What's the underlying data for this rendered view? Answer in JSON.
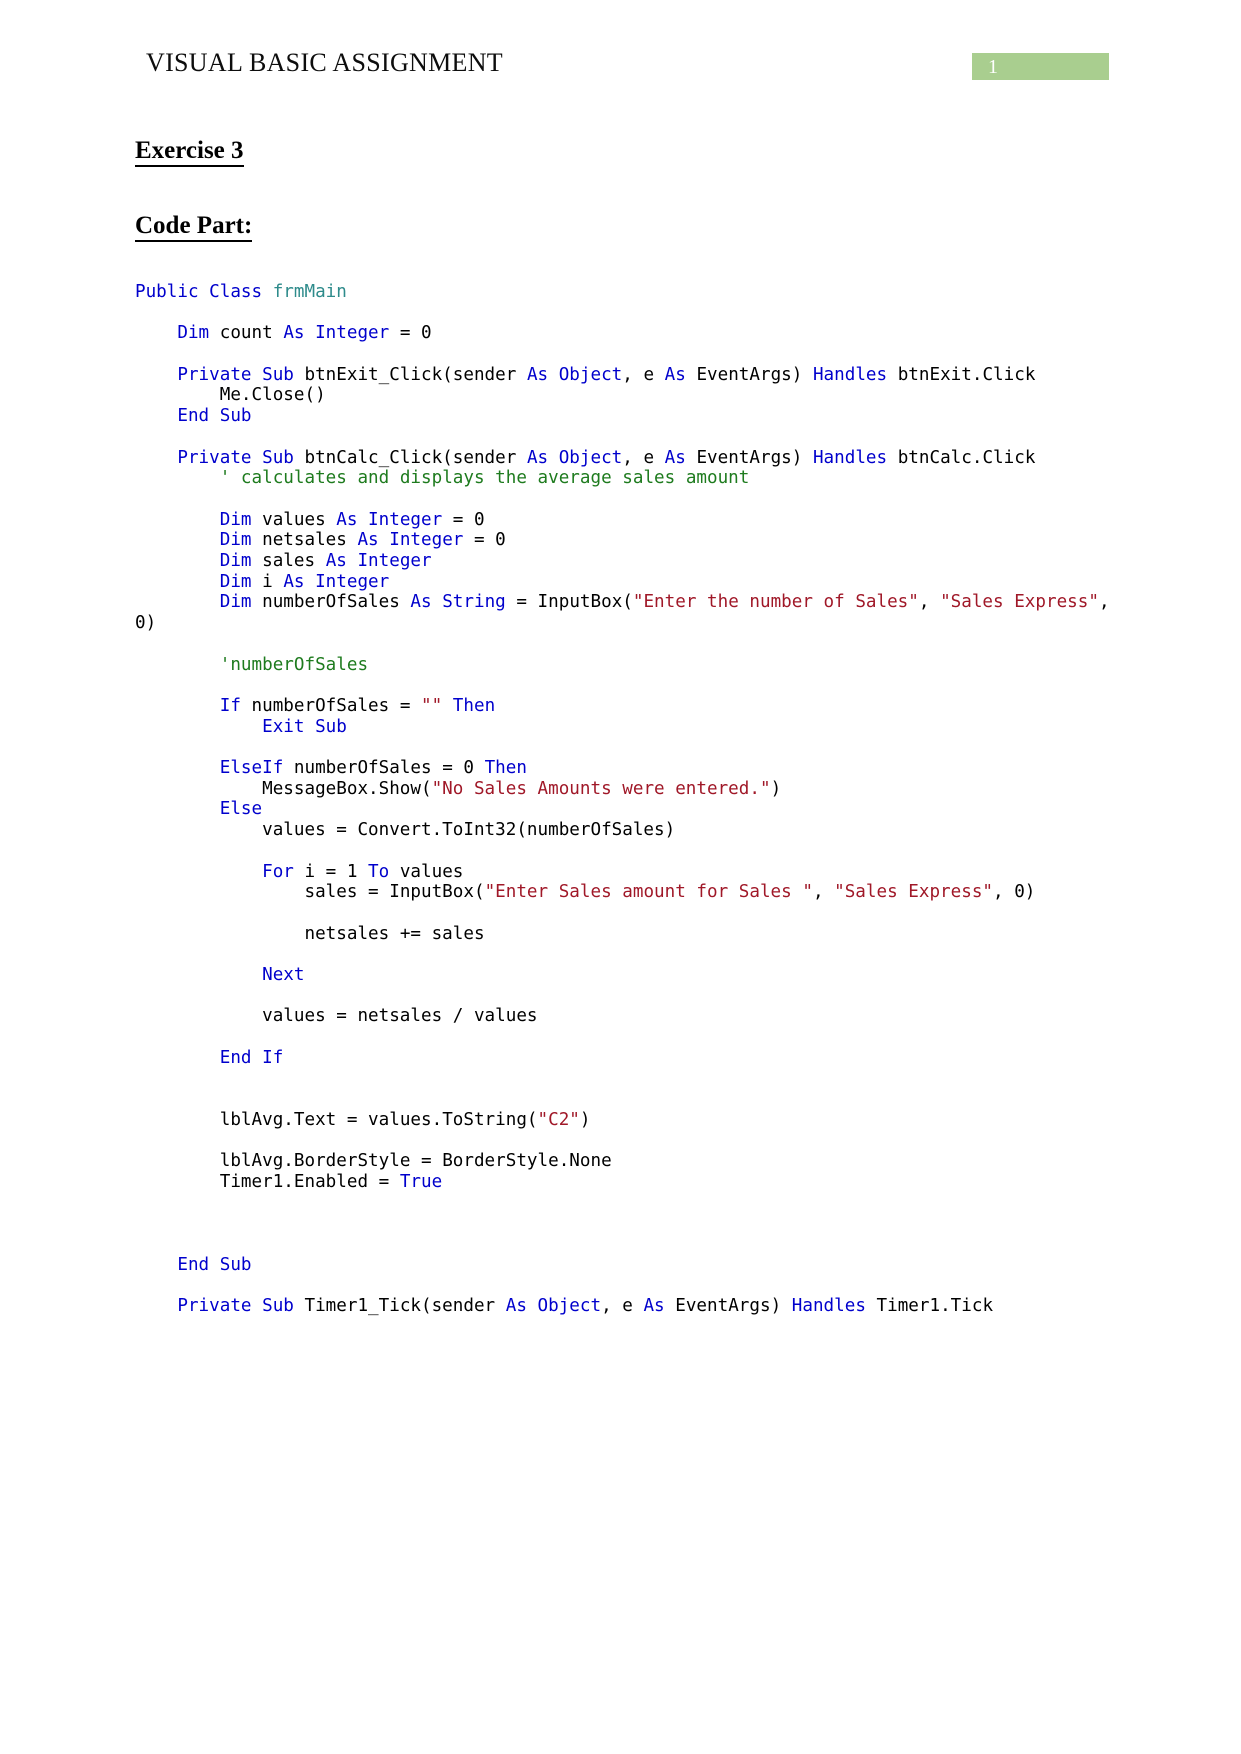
{
  "header": {
    "title": "VISUAL BASIC ASSIGNMENT",
    "page_number": "1",
    "badge_color": "#a9ce8f"
  },
  "headings": {
    "exercise": "Exercise 3",
    "code_part": "Code Part:"
  },
  "theme": {
    "keyword_color": "#0000cc",
    "type_color": "#2e8b8b",
    "comment_color": "#1e7b1e",
    "string_color": "#a01828",
    "text_color": "#000000"
  },
  "code": {
    "language": "Visual Basic",
    "lines": [
      [
        {
          "t": "Public Class ",
          "c": "kw"
        },
        {
          "t": "frmMain",
          "c": "type"
        }
      ],
      [],
      [
        {
          "t": "    ",
          "c": "txt"
        },
        {
          "t": "Dim ",
          "c": "kw"
        },
        {
          "t": "count ",
          "c": "txt"
        },
        {
          "t": "As Integer",
          "c": "kw"
        },
        {
          "t": " = 0",
          "c": "txt"
        }
      ],
      [],
      [
        {
          "t": "    ",
          "c": "txt"
        },
        {
          "t": "Private Sub ",
          "c": "kw"
        },
        {
          "t": "btnExit_Click(sender ",
          "c": "txt"
        },
        {
          "t": "As Object",
          "c": "kw"
        },
        {
          "t": ", e ",
          "c": "txt"
        },
        {
          "t": "As ",
          "c": "kw"
        },
        {
          "t": "EventArgs) ",
          "c": "txt"
        },
        {
          "t": "Handles ",
          "c": "kw"
        },
        {
          "t": "btnExit.Click",
          "c": "txt"
        }
      ],
      [
        {
          "t": "        Me.Close()",
          "c": "txt"
        }
      ],
      [
        {
          "t": "    ",
          "c": "txt"
        },
        {
          "t": "End Sub",
          "c": "kw"
        }
      ],
      [],
      [
        {
          "t": "    ",
          "c": "txt"
        },
        {
          "t": "Private Sub ",
          "c": "kw"
        },
        {
          "t": "btnCalc_Click(sender ",
          "c": "txt"
        },
        {
          "t": "As Object",
          "c": "kw"
        },
        {
          "t": ", e ",
          "c": "txt"
        },
        {
          "t": "As ",
          "c": "kw"
        },
        {
          "t": "EventArgs) ",
          "c": "txt"
        },
        {
          "t": "Handles ",
          "c": "kw"
        },
        {
          "t": "btnCalc.Click",
          "c": "txt"
        }
      ],
      [
        {
          "t": "        ",
          "c": "txt"
        },
        {
          "t": "' calculates and displays the average sales amount",
          "c": "cmt"
        }
      ],
      [],
      [
        {
          "t": "        ",
          "c": "txt"
        },
        {
          "t": "Dim ",
          "c": "kw"
        },
        {
          "t": "values ",
          "c": "txt"
        },
        {
          "t": "As Integer",
          "c": "kw"
        },
        {
          "t": " = 0",
          "c": "txt"
        }
      ],
      [
        {
          "t": "        ",
          "c": "txt"
        },
        {
          "t": "Dim ",
          "c": "kw"
        },
        {
          "t": "netsales ",
          "c": "txt"
        },
        {
          "t": "As Integer",
          "c": "kw"
        },
        {
          "t": " = 0",
          "c": "txt"
        }
      ],
      [
        {
          "t": "        ",
          "c": "txt"
        },
        {
          "t": "Dim ",
          "c": "kw"
        },
        {
          "t": "sales ",
          "c": "txt"
        },
        {
          "t": "As Integer",
          "c": "kw"
        }
      ],
      [
        {
          "t": "        ",
          "c": "txt"
        },
        {
          "t": "Dim ",
          "c": "kw"
        },
        {
          "t": "i ",
          "c": "txt"
        },
        {
          "t": "As Integer",
          "c": "kw"
        }
      ],
      [
        {
          "t": "        ",
          "c": "txt"
        },
        {
          "t": "Dim ",
          "c": "kw"
        },
        {
          "t": "numberOfSales ",
          "c": "txt"
        },
        {
          "t": "As String",
          "c": "kw"
        },
        {
          "t": " = InputBox(",
          "c": "txt"
        },
        {
          "t": "\"Enter the number of Sales\"",
          "c": "str"
        },
        {
          "t": ", ",
          "c": "txt"
        },
        {
          "t": "\"Sales Express\"",
          "c": "str"
        },
        {
          "t": ", 0)",
          "c": "txt"
        }
      ],
      [],
      [
        {
          "t": "        ",
          "c": "txt"
        },
        {
          "t": "'numberOfSales",
          "c": "cmt"
        }
      ],
      [],
      [
        {
          "t": "        ",
          "c": "txt"
        },
        {
          "t": "If ",
          "c": "kw"
        },
        {
          "t": "numberOfSales = ",
          "c": "txt"
        },
        {
          "t": "\"\"",
          "c": "str"
        },
        {
          "t": " ",
          "c": "txt"
        },
        {
          "t": "Then",
          "c": "kw"
        }
      ],
      [
        {
          "t": "            ",
          "c": "txt"
        },
        {
          "t": "Exit Sub",
          "c": "kw"
        }
      ],
      [],
      [
        {
          "t": "        ",
          "c": "txt"
        },
        {
          "t": "ElseIf ",
          "c": "kw"
        },
        {
          "t": "numberOfSales = 0 ",
          "c": "txt"
        },
        {
          "t": "Then",
          "c": "kw"
        }
      ],
      [
        {
          "t": "            MessageBox.Show(",
          "c": "txt"
        },
        {
          "t": "\"No Sales Amounts were entered.\"",
          "c": "str"
        },
        {
          "t": ")",
          "c": "txt"
        }
      ],
      [
        {
          "t": "        ",
          "c": "txt"
        },
        {
          "t": "Else",
          "c": "kw"
        }
      ],
      [
        {
          "t": "            values = Convert.ToInt32(numberOfSales)",
          "c": "txt"
        }
      ],
      [],
      [
        {
          "t": "            ",
          "c": "txt"
        },
        {
          "t": "For ",
          "c": "kw"
        },
        {
          "t": "i = 1 ",
          "c": "txt"
        },
        {
          "t": "To ",
          "c": "kw"
        },
        {
          "t": "values",
          "c": "txt"
        }
      ],
      [
        {
          "t": "                sales = InputBox(",
          "c": "txt"
        },
        {
          "t": "\"Enter Sales amount for Sales \"",
          "c": "str"
        },
        {
          "t": ", ",
          "c": "txt"
        },
        {
          "t": "\"Sales Express\"",
          "c": "str"
        },
        {
          "t": ", 0)",
          "c": "txt"
        }
      ],
      [],
      [
        {
          "t": "                netsales += sales",
          "c": "txt"
        }
      ],
      [],
      [
        {
          "t": "            ",
          "c": "txt"
        },
        {
          "t": "Next",
          "c": "kw"
        }
      ],
      [],
      [
        {
          "t": "            values = netsales / values",
          "c": "txt"
        }
      ],
      [],
      [
        {
          "t": "        ",
          "c": "txt"
        },
        {
          "t": "End If",
          "c": "kw"
        }
      ],
      [],
      [],
      [
        {
          "t": "        lblAvg.Text = values.ToString(",
          "c": "txt"
        },
        {
          "t": "\"C2\"",
          "c": "str"
        },
        {
          "t": ")",
          "c": "txt"
        }
      ],
      [],
      [
        {
          "t": "        lblAvg.BorderStyle = BorderStyle.None",
          "c": "txt"
        }
      ],
      [
        {
          "t": "        Timer1.Enabled = ",
          "c": "txt"
        },
        {
          "t": "True",
          "c": "kw"
        }
      ],
      [],
      [],
      [],
      [
        {
          "t": "    ",
          "c": "txt"
        },
        {
          "t": "End Sub",
          "c": "kw"
        }
      ],
      [],
      [
        {
          "t": "    ",
          "c": "txt"
        },
        {
          "t": "Private Sub ",
          "c": "kw"
        },
        {
          "t": "Timer1_Tick(sender ",
          "c": "txt"
        },
        {
          "t": "As Object",
          "c": "kw"
        },
        {
          "t": ", e ",
          "c": "txt"
        },
        {
          "t": "As ",
          "c": "kw"
        },
        {
          "t": "EventArgs) ",
          "c": "txt"
        },
        {
          "t": "Handles ",
          "c": "kw"
        },
        {
          "t": "Timer1.Tick",
          "c": "txt"
        }
      ]
    ]
  }
}
